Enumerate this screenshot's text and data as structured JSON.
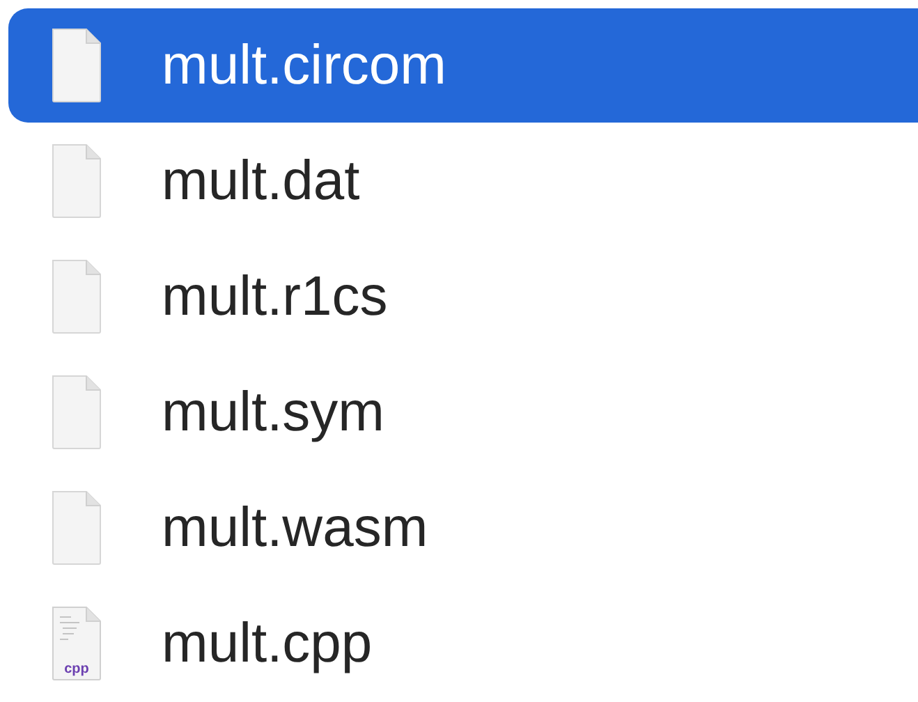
{
  "files": [
    {
      "name": "mult.circom",
      "kind": "document",
      "selected": true
    },
    {
      "name": "mult.dat",
      "kind": "document",
      "selected": false
    },
    {
      "name": "mult.r1cs",
      "kind": "document",
      "selected": false
    },
    {
      "name": "mult.sym",
      "kind": "document",
      "selected": false
    },
    {
      "name": "mult.wasm",
      "kind": "document",
      "selected": false
    },
    {
      "name": "mult.cpp",
      "kind": "source",
      "badge": "cpp",
      "selected": false
    }
  ]
}
